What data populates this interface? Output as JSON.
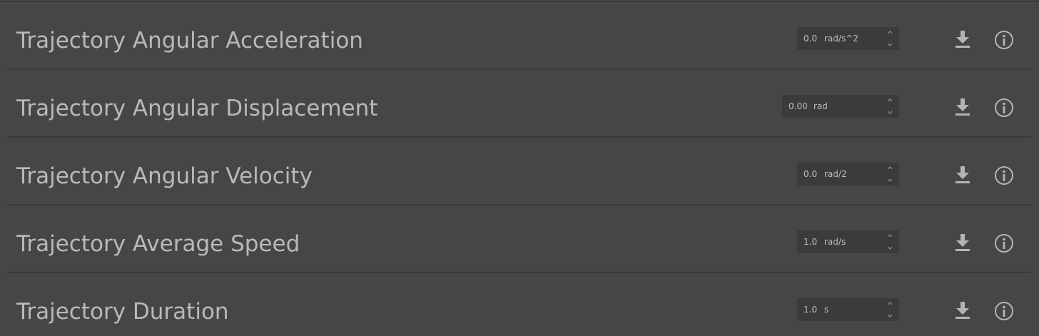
{
  "rows": [
    {
      "label": "Trajectory Angular Acceleration",
      "value": "0.0",
      "unit": "rad/s^2"
    },
    {
      "label": "Trajectory Angular Displacement",
      "value": "0.00",
      "unit": "rad"
    },
    {
      "label": "Trajectory Angular Velocity",
      "value": "0.0",
      "unit": "rad/2"
    },
    {
      "label": "Trajectory Average Speed",
      "value": "1.0",
      "unit": "rad/s"
    },
    {
      "label": "Trajectory Duration",
      "value": "1.0",
      "unit": "s"
    }
  ],
  "icons": {
    "download": "download-icon",
    "info": "info-icon",
    "spin_up": "chevron-up-icon",
    "spin_down": "chevron-down-icon"
  },
  "colors": {
    "background": "#464646",
    "separator": "#393939",
    "label_text": "#b9b9b9",
    "field_bg": "#3b3b3b",
    "icon": "#b4b4b4"
  }
}
